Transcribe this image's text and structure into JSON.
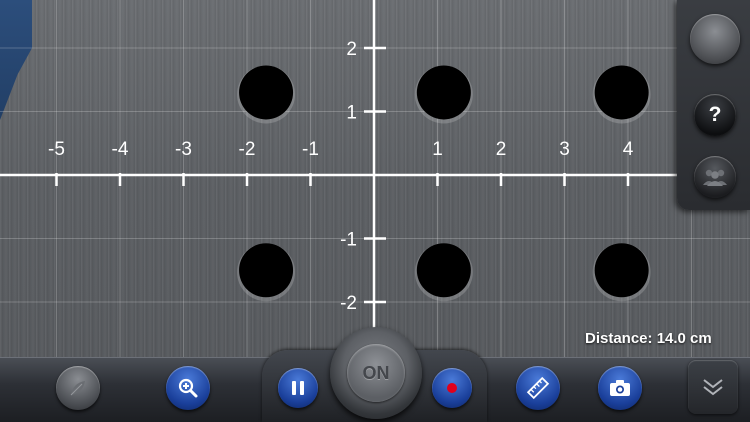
{
  "grid": {
    "x_axis_labels": [
      "-5",
      "-4",
      "-3",
      "-2",
      "-1",
      "1",
      "2",
      "3",
      "4"
    ],
    "y_axis_labels": [
      "2",
      "1",
      "-1",
      "-2"
    ]
  },
  "holes": [
    {
      "x": -1.7,
      "y": 1.3
    },
    {
      "x": 1.1,
      "y": 1.3
    },
    {
      "x": 3.9,
      "y": 1.3
    },
    {
      "x": -1.7,
      "y": -1.5
    },
    {
      "x": 1.1,
      "y": -1.5
    },
    {
      "x": 3.9,
      "y": -1.5
    }
  ],
  "status": {
    "distance": "Distance: 14.0 cm"
  },
  "right_panel": {
    "help_label": "?"
  },
  "toolbar": {
    "on_label": "ON"
  },
  "colors": {
    "accent_blue": "#1a3f9a",
    "record_red": "#e0001b"
  },
  "icons": {
    "help": "question-mark-icon",
    "group": "group-users-icon",
    "zoom": "zoom-in-icon",
    "pause": "pause-icon",
    "record": "record-icon",
    "ruler": "ruler-icon",
    "camera": "camera-icon",
    "expand": "double-chevron-down-icon",
    "leaf": "leaf-icon"
  }
}
